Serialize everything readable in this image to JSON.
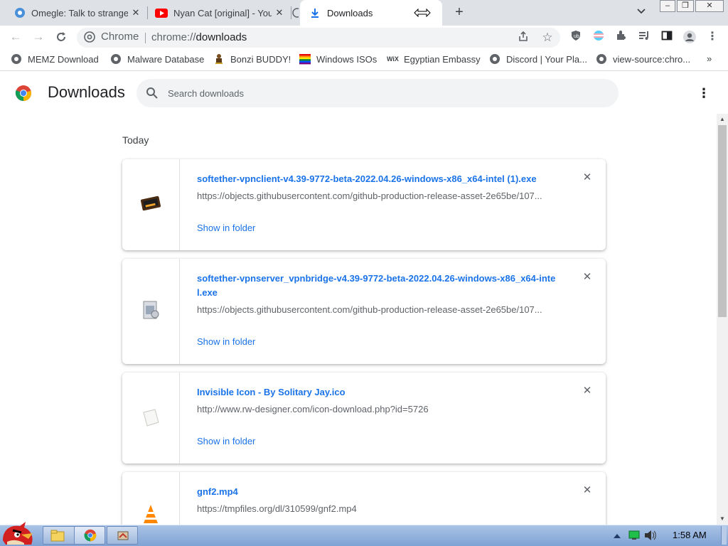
{
  "tabs": [
    {
      "title": "Omegle: Talk to strangers!",
      "icon": "omegle-icon"
    },
    {
      "title": "Nyan Cat [original] - YouTube",
      "icon": "youtube-icon"
    },
    {
      "title": "Downloads",
      "icon": "download-icon",
      "active": true
    }
  ],
  "toolbar": {
    "site_chip": "Chrome",
    "url_scheme": "chrome://",
    "url_host": "downloads"
  },
  "bookmarks": [
    {
      "label": "MEMZ Download",
      "icon": "globe-icon"
    },
    {
      "label": "Malware Database",
      "icon": "globe-icon"
    },
    {
      "label": "Bonzi BUDDY!",
      "icon": "bonzi-icon"
    },
    {
      "label": "Windows ISOs",
      "icon": "rainbow-flag-icon"
    },
    {
      "label": "Egyptian Embassy",
      "icon": "wix-icon"
    },
    {
      "label": "Discord | Your Pla...",
      "icon": "globe-icon"
    },
    {
      "label": "view-source:chro...",
      "icon": "globe-icon"
    }
  ],
  "bookmarks_more": "»",
  "downloads": {
    "title": "Downloads",
    "search_placeholder": "Search downloads",
    "section_label": "Today",
    "show_in_folder": "Show in folder",
    "items": [
      {
        "filename": "softether-vpnclient-v4.39-9772-beta-2022.04.26-windows-x86_x64-intel (1).exe",
        "url": "https://objects.githubusercontent.com/github-production-release-asset-2e65be/107...",
        "icon": "installer-icon"
      },
      {
        "filename": "softether-vpnserver_vpnbridge-v4.39-9772-beta-2022.04.26-windows-x86_x64-intel.exe",
        "url": "https://objects.githubusercontent.com/github-production-release-asset-2e65be/107...",
        "icon": "setup-icon"
      },
      {
        "filename": "Invisible Icon - By Solitary Jay.ico",
        "url": "http://www.rw-designer.com/icon-download.php?id=5726",
        "icon": "blank-file-icon"
      },
      {
        "filename": "gnf2.mp4",
        "url": "https://tmpfiles.org/dl/310599/gnf2.mp4",
        "icon": "vlc-icon"
      }
    ]
  },
  "taskbar": {
    "clock": "1:58 AM"
  },
  "colors": {
    "accent": "#1a73e8",
    "tabstrip": "#dee1e6",
    "taskbar": "#8fb0dc"
  }
}
